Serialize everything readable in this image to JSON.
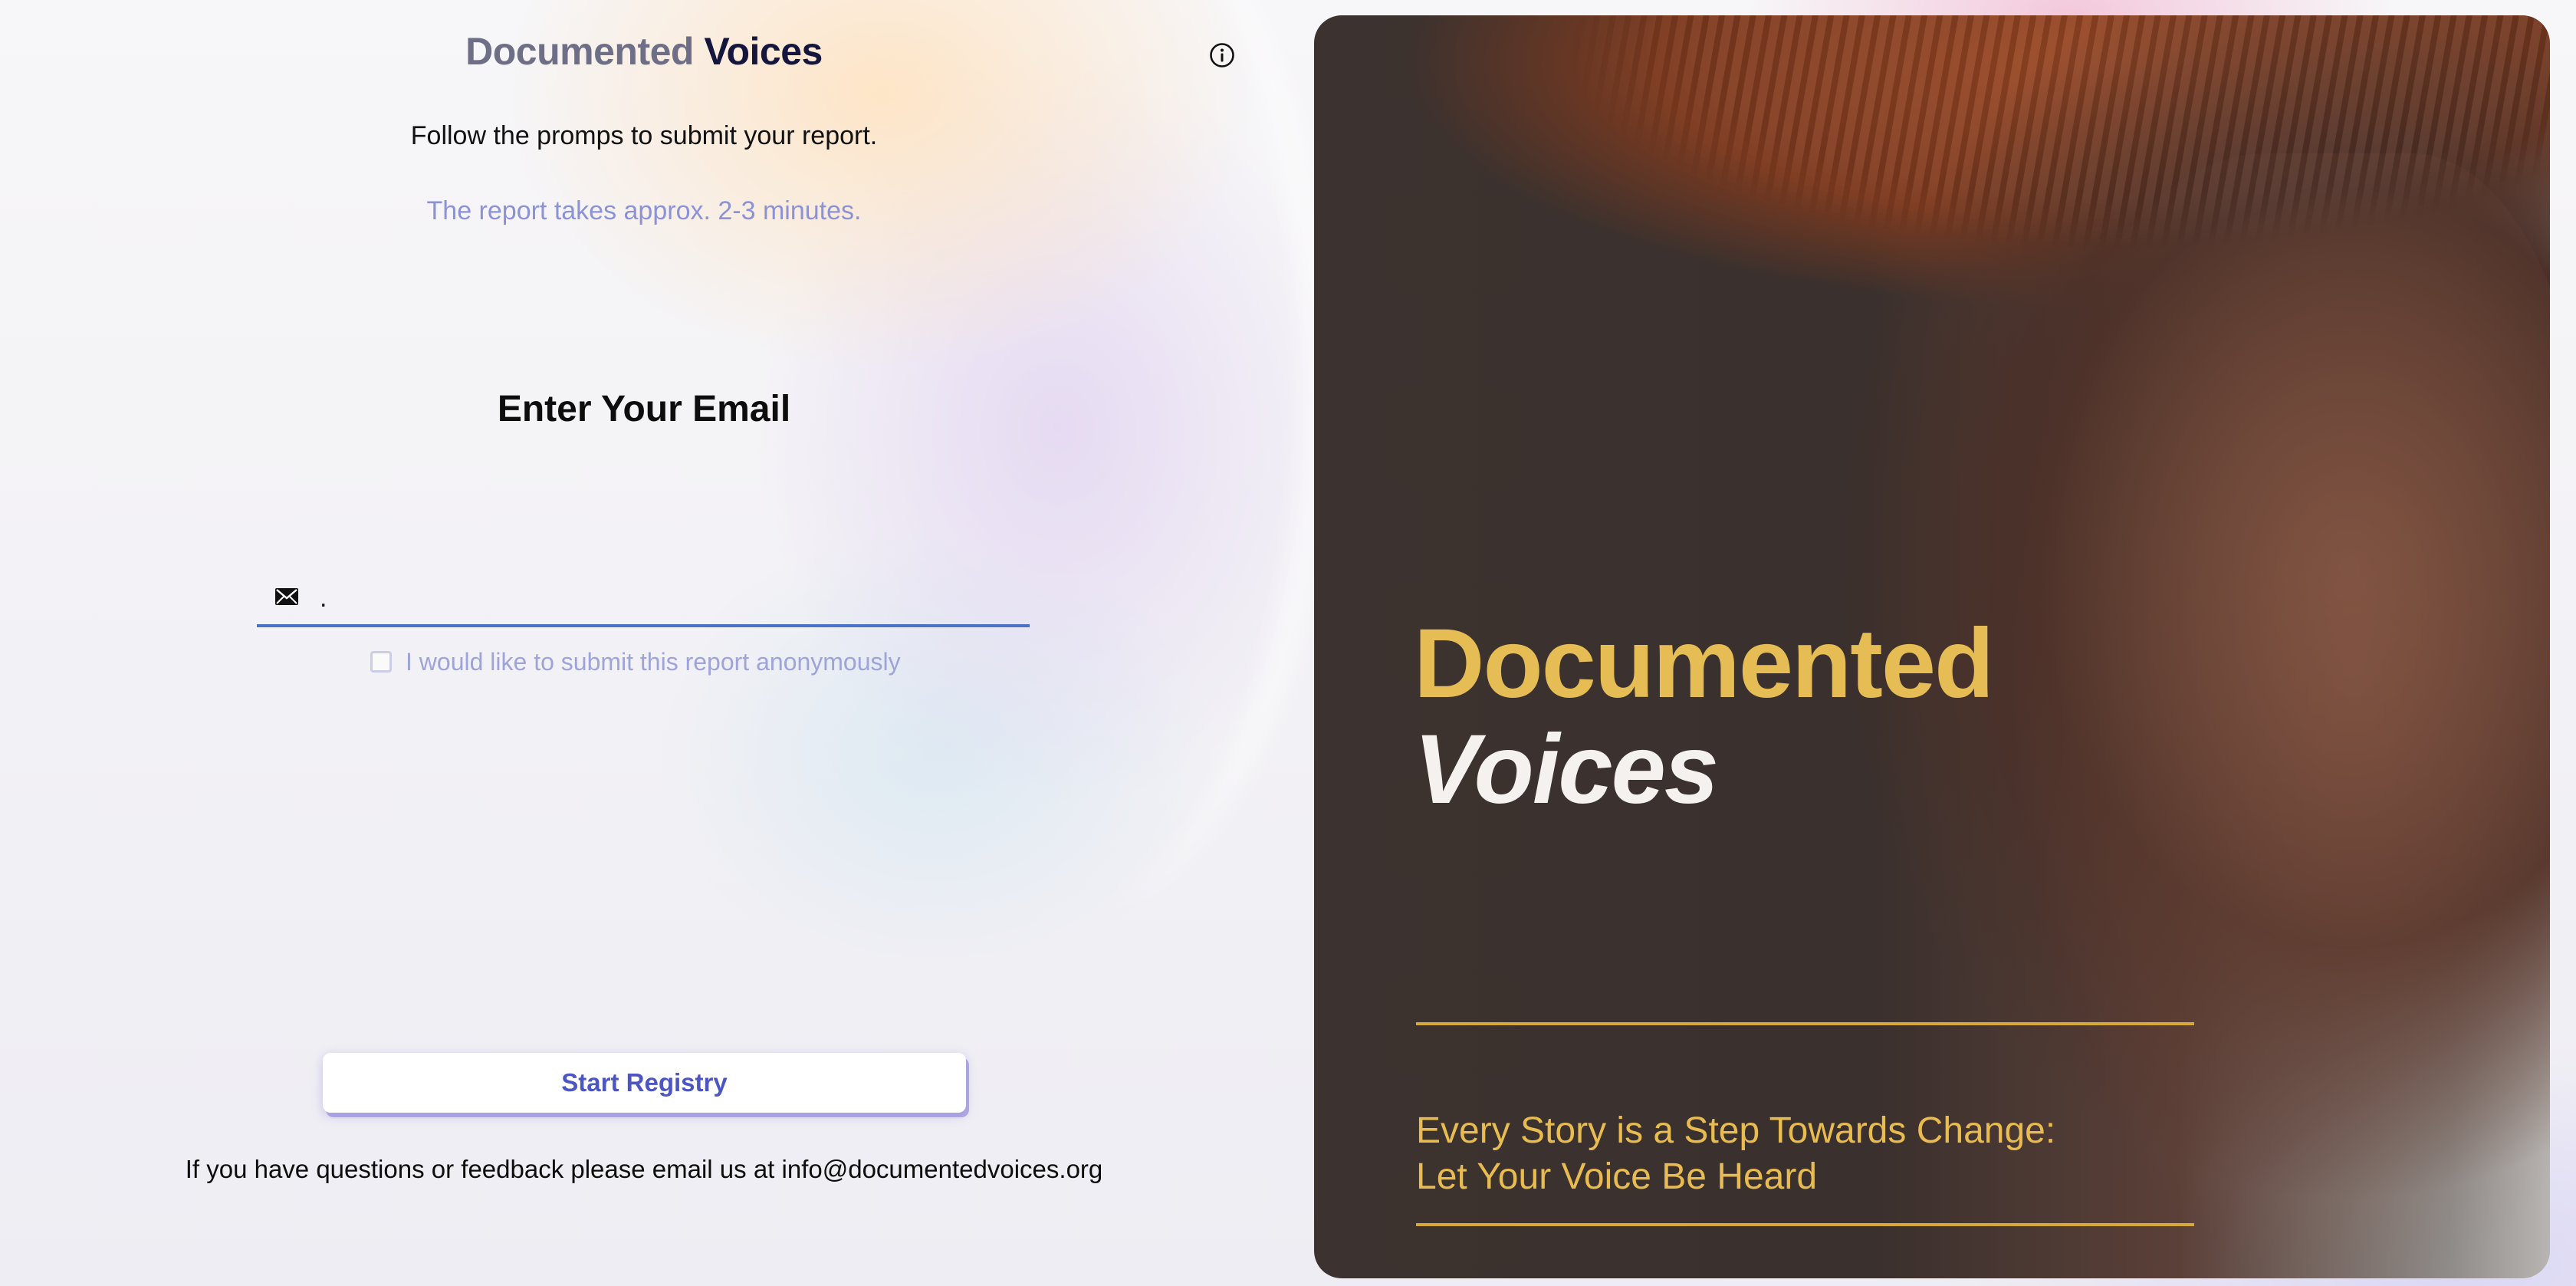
{
  "brand": {
    "word1": "Documented",
    "word2": "Voices"
  },
  "form": {
    "subtitle": "Follow the promps to submit your report.",
    "duration": "The report takes approx. 2-3 minutes.",
    "heading": "Enter Your Email",
    "email_value": ".",
    "anonymous_label": "I would like to submit this report anonymously",
    "start_button": "Start Registry",
    "footer_note": "If you have questions or feedback please email us at info@documentedvoices.org"
  },
  "hero": {
    "title_line1": "Documented",
    "title_line2": "Voices",
    "tagline_line1": "Every Story is a Step Towards Change:",
    "tagline_line2": "Let Your Voice Be Heard"
  },
  "icons": {
    "info": "info-icon",
    "mail": "mail-icon"
  },
  "colors": {
    "accent": "#4d55c2",
    "input_underline": "#4a72c9",
    "muted_text": "#8c92d6",
    "hero_gold": "#e5bd54"
  }
}
